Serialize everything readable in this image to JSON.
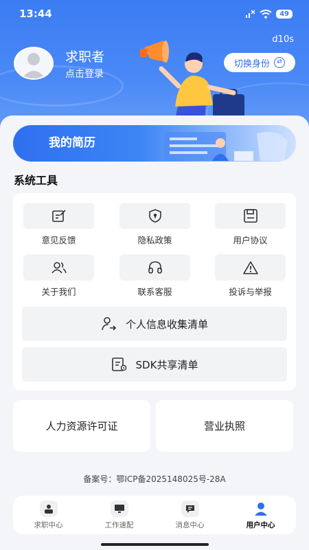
{
  "status_bar": {
    "time": "13:44",
    "battery": "49"
  },
  "timer": "d10s",
  "profile": {
    "name": "求职者",
    "login": "点击登录",
    "switch_label": "切换身份"
  },
  "resume_banner": {
    "label": "我的简历"
  },
  "tools_section": {
    "title": "系统工具",
    "items": [
      {
        "label": "意见反馈",
        "icon": "feedback-edit-icon"
      },
      {
        "label": "隐私政策",
        "icon": "privacy-shield-icon"
      },
      {
        "label": "用户协议",
        "icon": "agreement-save-icon"
      },
      {
        "label": "关于我们",
        "icon": "users-icon"
      },
      {
        "label": "联系客服",
        "icon": "headset-icon"
      },
      {
        "label": "投诉与举报",
        "icon": "warning-icon"
      }
    ],
    "wide_buttons": [
      {
        "label": "个人信息收集清单",
        "icon": "user-arrow-icon"
      },
      {
        "label": "SDK共享清单",
        "icon": "document-list-icon"
      }
    ]
  },
  "certificates": [
    {
      "label": "人力资源许可证"
    },
    {
      "label": "营业执照"
    }
  ],
  "icp": "备案号：鄂ICP备2025148025号-28A",
  "tabbar": [
    {
      "label": "求职中心",
      "icon": "job-center-icon",
      "active": false
    },
    {
      "label": "工作速配",
      "icon": "monitor-icon",
      "active": false
    },
    {
      "label": "消息中心",
      "icon": "message-icon",
      "active": false
    },
    {
      "label": "用户中心",
      "icon": "user-center-icon",
      "active": true
    }
  ],
  "colors": {
    "primary": "#2f6fef",
    "header": "#3b7cf3",
    "background": "#f3f5f9"
  }
}
